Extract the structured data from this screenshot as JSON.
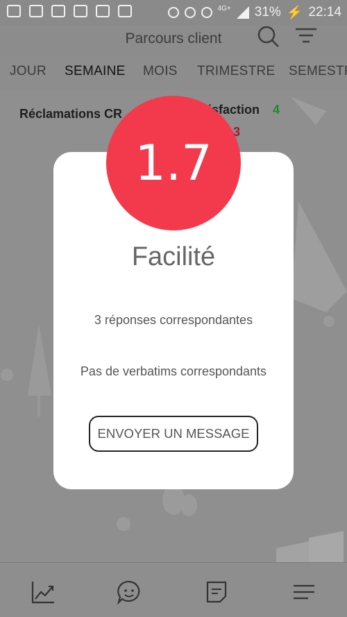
{
  "status_bar": {
    "network": "4G+",
    "battery": "31%",
    "time": "22:14"
  },
  "header": {
    "title": "Parcours client"
  },
  "tabs": [
    {
      "label": "JOUR"
    },
    {
      "label": "SEMAINE"
    },
    {
      "label": "MOIS"
    },
    {
      "label": "TRIMESTRE"
    },
    {
      "label": "SEMESTR"
    }
  ],
  "dashboard": {
    "reclamations_label": "Réclamations CR",
    "satisfaction_label": "tisfaction",
    "satisfaction_value": "4",
    "red_value": "3"
  },
  "modal": {
    "score": "1.7",
    "title": "Facilité",
    "responses": "3 réponses correspondantes",
    "verbatims": "Pas de verbatims correspondants",
    "button_label": "ENVOYER UN MESSAGE"
  },
  "colors": {
    "score_red": "#f23a4c",
    "overlay_gray": "#8f8f8f",
    "green": "#1c8a2d"
  },
  "bottom_nav": [
    {
      "icon": "chart-line-icon"
    },
    {
      "icon": "chat-face-icon"
    },
    {
      "icon": "document-icon"
    },
    {
      "icon": "menu-icon"
    }
  ]
}
